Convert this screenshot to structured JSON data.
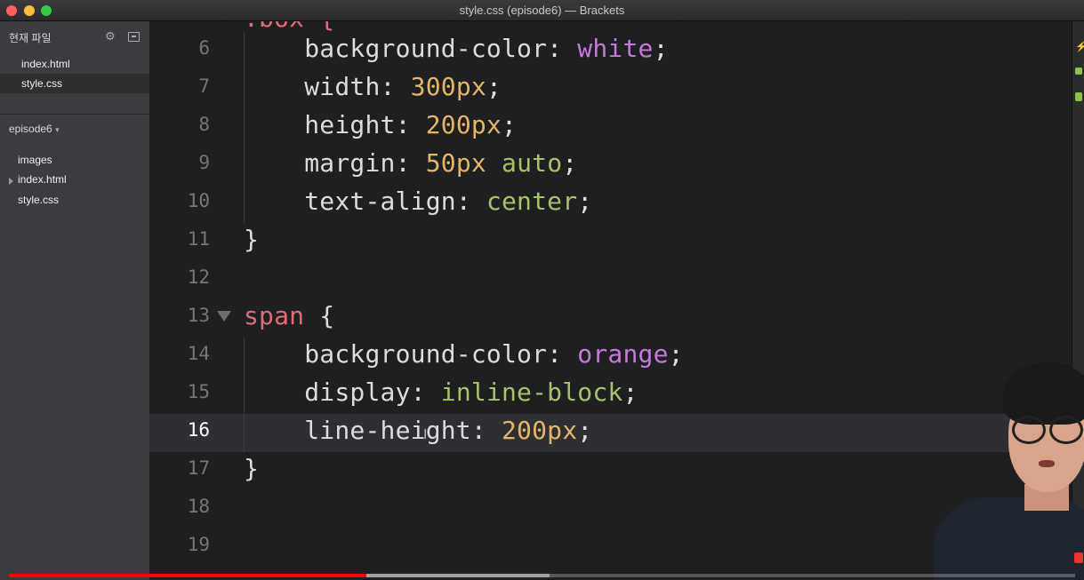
{
  "window": {
    "title": "style.css (episode6) — Brackets"
  },
  "sidebar": {
    "working_files_label": "현재 파일",
    "working_files": [
      {
        "name": "index.html",
        "active": false
      },
      {
        "name": "style.css",
        "active": true
      }
    ],
    "project_name": "episode6",
    "project_caret": "▾",
    "tree": [
      {
        "name": "images",
        "type": "folder"
      },
      {
        "name": "index.html",
        "type": "file"
      },
      {
        "name": "style.css",
        "type": "file"
      }
    ]
  },
  "editor": {
    "partial_top_line": ".box {",
    "active_line": 16,
    "lines": [
      {
        "n": "6",
        "tokens": [
          [
            "prop",
            "background-color"
          ],
          [
            "punc",
            ": "
          ],
          [
            "val-purple",
            "white"
          ],
          [
            "punc",
            ";"
          ]
        ],
        "indent": true
      },
      {
        "n": "7",
        "tokens": [
          [
            "prop",
            "width"
          ],
          [
            "punc",
            ": "
          ],
          [
            "val-num",
            "300px"
          ],
          [
            "punc",
            ";"
          ]
        ],
        "indent": true
      },
      {
        "n": "8",
        "tokens": [
          [
            "prop",
            "height"
          ],
          [
            "punc",
            ": "
          ],
          [
            "val-num",
            "200px"
          ],
          [
            "punc",
            ";"
          ]
        ],
        "indent": true
      },
      {
        "n": "9",
        "tokens": [
          [
            "prop",
            "margin"
          ],
          [
            "punc",
            ": "
          ],
          [
            "val-num",
            "50px"
          ],
          [
            "punc",
            " "
          ],
          [
            "val-green",
            "auto"
          ],
          [
            "punc",
            ";"
          ]
        ],
        "indent": true
      },
      {
        "n": "10",
        "tokens": [
          [
            "prop",
            "text-align"
          ],
          [
            "punc",
            ": "
          ],
          [
            "val-green",
            "center"
          ],
          [
            "punc",
            ";"
          ]
        ],
        "indent": true
      },
      {
        "n": "11",
        "tokens": [
          [
            "brace",
            "}"
          ]
        ],
        "indent": false
      },
      {
        "n": "12",
        "tokens": [],
        "indent": false
      },
      {
        "n": "13",
        "tokens": [
          [
            "sel",
            "span"
          ],
          [
            "brace",
            " {"
          ]
        ],
        "indent": false,
        "fold": true
      },
      {
        "n": "14",
        "tokens": [
          [
            "prop",
            "background-color"
          ],
          [
            "punc",
            ": "
          ],
          [
            "val-purple",
            "orange"
          ],
          [
            "punc",
            ";"
          ]
        ],
        "indent": true
      },
      {
        "n": "15",
        "tokens": [
          [
            "prop",
            "display"
          ],
          [
            "punc",
            ": "
          ],
          [
            "val-green",
            "inline-block"
          ],
          [
            "punc",
            ";"
          ]
        ],
        "indent": true
      },
      {
        "n": "16",
        "tokens": [
          [
            "prop",
            "line-height"
          ],
          [
            "punc",
            ": "
          ],
          [
            "val-num",
            "200px"
          ],
          [
            "punc",
            ";"
          ]
        ],
        "indent": true
      },
      {
        "n": "17",
        "tokens": [
          [
            "brace",
            "}"
          ]
        ],
        "indent": false
      },
      {
        "n": "18",
        "tokens": [],
        "indent": false
      },
      {
        "n": "19",
        "tokens": [],
        "indent": false
      }
    ]
  },
  "video": {
    "played_fraction": 0.335,
    "buffered_fraction": 0.507
  },
  "colors": {
    "accent_red": "#ff0000",
    "keyword_purple": "#c678dd",
    "number_orange": "#e5b567",
    "value_green": "#a8c26a",
    "selector_red": "#e06c75"
  }
}
